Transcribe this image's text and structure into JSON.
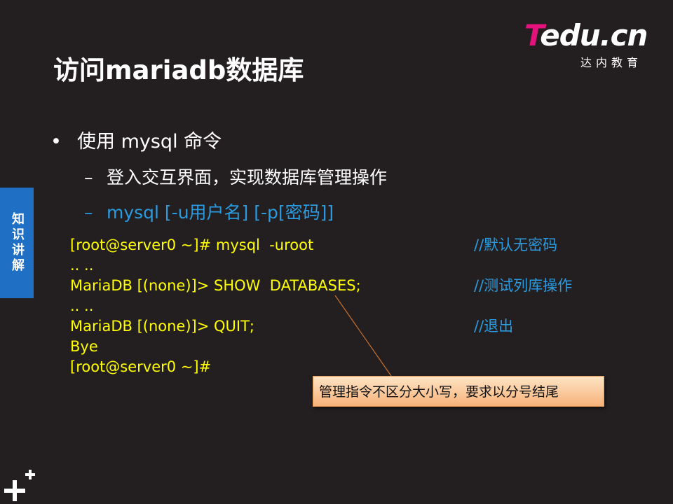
{
  "title": "访问mariadb数据库",
  "logo": {
    "brand_t": "T",
    "brand_rest": "edu.cn",
    "subtitle": "达内教育",
    "accent_color": "#e5127d"
  },
  "side_tab": {
    "label": "知识讲解",
    "color": "#1f6fc4"
  },
  "bullets": {
    "level1": {
      "marker": "•",
      "text": "使用 mysql 命令"
    },
    "level2": [
      {
        "marker": "–",
        "text": "登入交互界面，实现数据库管理操作"
      },
      {
        "marker": "–",
        "text": "mysql  [-u用户名]  [-p[密码]]"
      }
    ]
  },
  "code_lines": [
    "[root@server0 ~]# mysql  -uroot",
    ".. ..",
    "MariaDB [(none)]> SHOW  DATABASES;",
    ".. ..",
    "MariaDB [(none)]> QUIT;",
    "Bye",
    "[root@server0 ~]#"
  ],
  "comments": [
    "//默认无密码",
    "",
    "//测试列库操作",
    "",
    "//退出"
  ],
  "callout": {
    "text": "管理指令不区分大小写，要求以分号结尾"
  },
  "colors": {
    "background": "#231f20",
    "code": "#ffff00",
    "comment": "#2a9be0",
    "highlight": "#2a9be0"
  },
  "icons": {
    "corner": "plus-icon"
  }
}
